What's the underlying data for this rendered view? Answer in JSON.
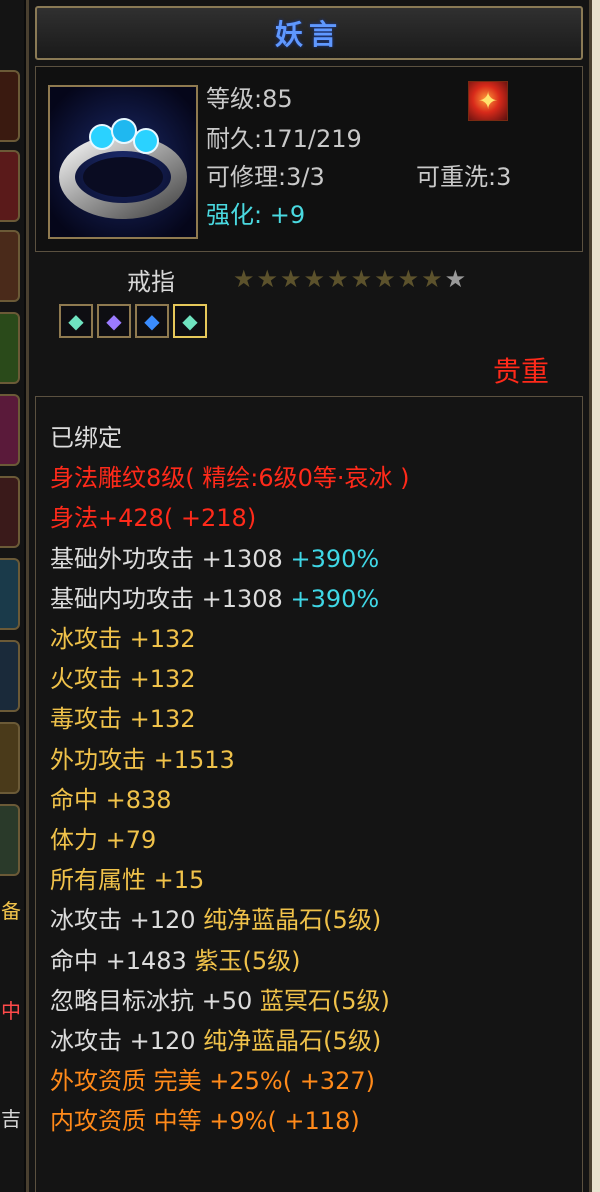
{
  "item": {
    "name": "妖言",
    "level": "等级:85",
    "durability": "耐久:171/219",
    "repair": "可修理:3/3",
    "rewash": "可重洗:3",
    "enhance": "强化: +9",
    "type": "戒指",
    "stars_filled": 9,
    "stars_total": 10,
    "rarity": "贵重",
    "gem_slots": [
      "gem-green",
      "gem-purple",
      "gem-blue",
      "gem-green"
    ]
  },
  "attributes": [
    {
      "text": "已绑定",
      "color": "white"
    },
    {
      "text": "身法雕纹8级( 精绘:6级0等·哀冰 )",
      "color": "red"
    },
    {
      "text": "身法+428( +218)",
      "color": "red"
    },
    {
      "text": "基础外功攻击 +1308",
      "extra": " +390%",
      "color": "white"
    },
    {
      "text": "基础内功攻击 +1308",
      "extra": " +390%",
      "color": "white"
    },
    {
      "text": "冰攻击 +132",
      "color": "yellow"
    },
    {
      "text": "火攻击 +132",
      "color": "yellow"
    },
    {
      "text": "毒攻击 +132",
      "color": "yellow"
    },
    {
      "text": "外功攻击 +1513",
      "color": "yellow"
    },
    {
      "text": "命中 +838",
      "color": "yellow"
    },
    {
      "text": "体力 +79",
      "color": "yellow"
    },
    {
      "text": "所有属性 +15",
      "color": "yellow"
    },
    {
      "text": "冰攻击 +120 ",
      "extra": "纯净蓝晶石(5级)",
      "color": "white"
    },
    {
      "text": "命中 +1483 ",
      "extra": "紫玉(5级)",
      "color": "white"
    },
    {
      "text": "忽略目标冰抗 +50 ",
      "extra": "蓝冥石(5级)",
      "color": "white"
    },
    {
      "text": "冰攻击 +120 ",
      "extra": "纯净蓝晶石(5级)",
      "color": "white"
    },
    {
      "text": "外攻资质  完美 +25%( +327)",
      "color": "orange"
    },
    {
      "text": "内攻资质  中等 +9%( +118)",
      "color": "orange"
    }
  ],
  "side_labels": [
    "备",
    "中",
    "吉"
  ],
  "colors": {
    "title": "#5f98ff",
    "enhance": "#4ad9e0",
    "rarity": "#ff2a1a",
    "bound": "#dcdcdc",
    "red": "#ff2a1a",
    "cyan": "#3fd7e6",
    "yellow": "#f0c24a",
    "orange": "#ff8a1a"
  }
}
